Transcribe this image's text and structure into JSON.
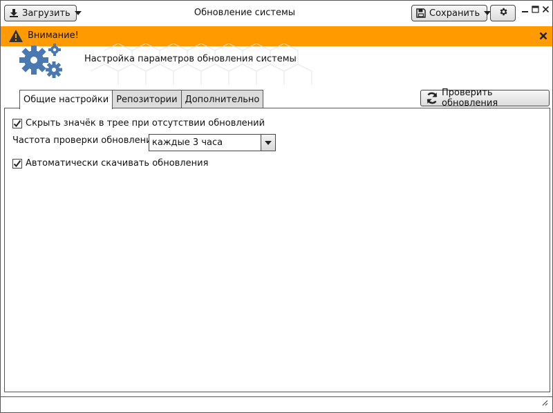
{
  "window": {
    "title": "Обновление системы",
    "load_label": "Загрузить",
    "save_label": "Сохранить"
  },
  "alert": {
    "text": "Внимание!",
    "color": "#ff9a00"
  },
  "header": {
    "text": "Настройка параметров обновления системы",
    "icon_color": "#4a78b0"
  },
  "tabs": [
    {
      "label": "Общие настройки",
      "active": true
    },
    {
      "label": "Репозитории",
      "active": false
    },
    {
      "label": "Дополнительно",
      "active": false
    }
  ],
  "check_updates_label": "Проверить обновления",
  "settings": {
    "hide_icon": {
      "label": "Скрыть значёк в трее при отсутствии обновлений",
      "checked": true
    },
    "frequency": {
      "label": "Частота проверки обновлений",
      "value": "каждые 3 часа"
    },
    "auto_download": {
      "label": "Автоматически скачивать обновления",
      "checked": true
    }
  },
  "icons": {
    "load": "download-icon",
    "save": "floppy-icon",
    "settings": "gear-icon",
    "alert": "warning-icon",
    "refresh": "refresh-icon"
  }
}
